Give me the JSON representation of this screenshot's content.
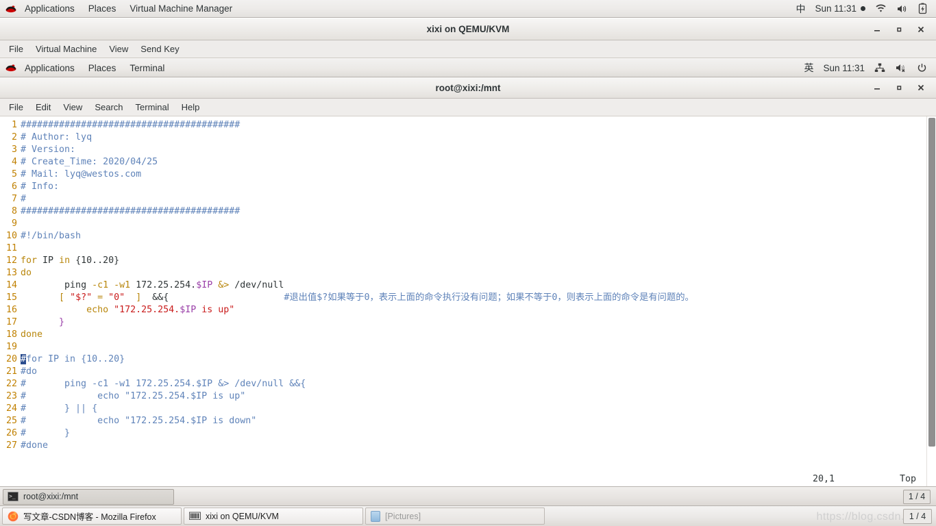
{
  "host_panel": {
    "logo": "redhat-logo",
    "menus": [
      "Applications",
      "Places",
      "Virtual Machine Manager"
    ],
    "ime": "中",
    "clock": "Sun 11:31",
    "tray": [
      "record-dot",
      "wifi-icon",
      "volume-icon",
      "battery-icon"
    ]
  },
  "vm_window": {
    "title": "xixi on QEMU/KVM",
    "menus": [
      "File",
      "Virtual Machine",
      "View",
      "Send Key"
    ],
    "window_buttons": [
      "minimize",
      "maximize",
      "close"
    ]
  },
  "guest_panel": {
    "logo": "redhat-logo",
    "menus": [
      "Applications",
      "Places",
      "Terminal"
    ],
    "ime": "英",
    "clock": "Sun 11:31",
    "tray": [
      "network-icon",
      "volume-muted-icon",
      "power-icon"
    ]
  },
  "terminal_window": {
    "title": "root@xixi:/mnt",
    "menus": [
      "File",
      "Edit",
      "View",
      "Search",
      "Terminal",
      "Help"
    ],
    "window_buttons": [
      "minimize",
      "maximize",
      "close"
    ]
  },
  "editor": {
    "status_position": "20,1",
    "status_scroll": "Top",
    "lines": [
      {
        "n": "1",
        "tokens": [
          {
            "t": "cmt",
            "s": "########################################"
          }
        ]
      },
      {
        "n": "2",
        "tokens": [
          {
            "t": "cmt",
            "s": "# Author: lyq"
          }
        ]
      },
      {
        "n": "3",
        "tokens": [
          {
            "t": "cmt",
            "s": "# Version:"
          }
        ]
      },
      {
        "n": "4",
        "tokens": [
          {
            "t": "cmt",
            "s": "# Create_Time: 2020/04/25"
          }
        ]
      },
      {
        "n": "5",
        "tokens": [
          {
            "t": "cmt",
            "s": "# Mail: lyq@westos.com"
          }
        ]
      },
      {
        "n": "6",
        "tokens": [
          {
            "t": "cmt",
            "s": "# Info:"
          }
        ]
      },
      {
        "n": "7",
        "tokens": [
          {
            "t": "cmt",
            "s": "#"
          }
        ]
      },
      {
        "n": "8",
        "tokens": [
          {
            "t": "cmt",
            "s": "########################################"
          }
        ]
      },
      {
        "n": "9",
        "tokens": []
      },
      {
        "n": "10",
        "tokens": [
          {
            "t": "cmt",
            "s": "#!/bin/bash"
          }
        ]
      },
      {
        "n": "11",
        "tokens": []
      },
      {
        "n": "12",
        "tokens": [
          {
            "t": "kw",
            "s": "for"
          },
          {
            "t": "plain",
            "s": " IP "
          },
          {
            "t": "kw",
            "s": "in"
          },
          {
            "t": "plain",
            "s": " {10..20}"
          }
        ]
      },
      {
        "n": "13",
        "tokens": [
          {
            "t": "kw",
            "s": "do"
          }
        ]
      },
      {
        "n": "14",
        "tokens": [
          {
            "t": "plain",
            "s": "        "
          },
          {
            "t": "plain",
            "s": "ping "
          },
          {
            "t": "kw",
            "s": "-c1 -w1"
          },
          {
            "t": "plain",
            "s": " 172.25.254."
          },
          {
            "t": "var",
            "s": "$IP"
          },
          {
            "t": "plain",
            "s": " "
          },
          {
            "t": "kw",
            "s": "&>"
          },
          {
            "t": "plain",
            "s": " /dev/null"
          }
        ]
      },
      {
        "n": "15",
        "tokens": [
          {
            "t": "plain",
            "s": "       "
          },
          {
            "t": "kw",
            "s": "["
          },
          {
            "t": "plain",
            "s": " "
          },
          {
            "t": "str",
            "s": "\"$?\""
          },
          {
            "t": "plain",
            "s": " "
          },
          {
            "t": "kw",
            "s": "="
          },
          {
            "t": "plain",
            "s": " "
          },
          {
            "t": "str",
            "s": "\"0\""
          },
          {
            "t": "plain",
            "s": "  "
          },
          {
            "t": "kw",
            "s": "]"
          },
          {
            "t": "plain",
            "s": "  &&{                     "
          },
          {
            "t": "cmt",
            "s": "#退出值$?如果等于0，表示上面的命令执行没有问题；如果不等于0，则表示上面的命令是有问题的。"
          }
        ]
      },
      {
        "n": "16",
        "tokens": [
          {
            "t": "plain",
            "s": "            "
          },
          {
            "t": "kw",
            "s": "echo"
          },
          {
            "t": "plain",
            "s": " "
          },
          {
            "t": "str",
            "s": "\"172.25.254."
          },
          {
            "t": "var",
            "s": "$IP"
          },
          {
            "t": "str",
            "s": " is up\""
          }
        ]
      },
      {
        "n": "17",
        "tokens": [
          {
            "t": "plain",
            "s": "       "
          },
          {
            "t": "var",
            "s": "}"
          }
        ]
      },
      {
        "n": "18",
        "tokens": [
          {
            "t": "kw",
            "s": "done"
          }
        ]
      },
      {
        "n": "19",
        "tokens": []
      },
      {
        "n": "20",
        "tokens": [
          {
            "t": "cursor",
            "s": "#"
          },
          {
            "t": "cmt",
            "s": "for IP in {10..20}"
          }
        ]
      },
      {
        "n": "21",
        "tokens": [
          {
            "t": "cmt",
            "s": "#do"
          }
        ]
      },
      {
        "n": "22",
        "tokens": [
          {
            "t": "cmt",
            "s": "#       ping -c1 -w1 172.25.254.$IP &> /dev/null &&{"
          }
        ]
      },
      {
        "n": "23",
        "tokens": [
          {
            "t": "cmt",
            "s": "#             echo \"172.25.254.$IP is up\""
          }
        ]
      },
      {
        "n": "24",
        "tokens": [
          {
            "t": "cmt",
            "s": "#       } || {"
          }
        ]
      },
      {
        "n": "25",
        "tokens": [
          {
            "t": "cmt",
            "s": "#             echo \"172.25.254.$IP is down\""
          }
        ]
      },
      {
        "n": "26",
        "tokens": [
          {
            "t": "cmt",
            "s": "#       }"
          }
        ]
      },
      {
        "n": "27",
        "tokens": [
          {
            "t": "cmt",
            "s": "#done"
          }
        ]
      }
    ]
  },
  "guest_taskbar": {
    "window_button": "root@xixi:/mnt",
    "workspace": "1 / 4"
  },
  "host_taskbar": {
    "items": [
      {
        "label": "写文章-CSDN博客 - Mozilla Firefox",
        "icon": "firefox-icon",
        "active": true
      },
      {
        "label": "xixi on QEMU/KVM",
        "icon": "vm-icon",
        "active": true
      },
      {
        "label": "[Pictures]",
        "icon": "pictures-icon",
        "active": false
      }
    ],
    "workspace": "1 / 4",
    "watermark": "https://blog.csdn.net/"
  }
}
